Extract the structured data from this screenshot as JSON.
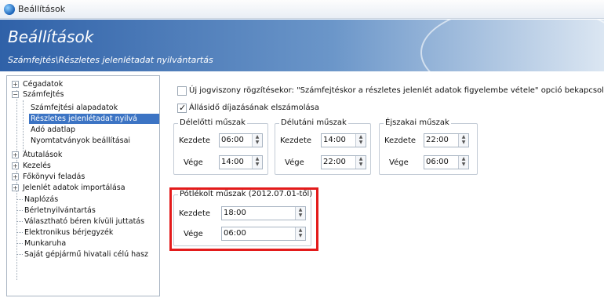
{
  "window": {
    "title": "Beállítások"
  },
  "banner": {
    "title": "Beállítások",
    "subtitle": "Számfejtés\\Részletes jelenlétadat nyilvántartás"
  },
  "sidebar": {
    "items": [
      {
        "label": "Cégadatok",
        "expander": "+"
      },
      {
        "label": "Számfejtés",
        "expander": "−"
      },
      {
        "label": "Számfejtési alapadatok"
      },
      {
        "label": "Részletes jelenlétadat nyilvá"
      },
      {
        "label": "Adó adatlap"
      },
      {
        "label": "Nyomtatványok beállításai"
      },
      {
        "label": "Átutalások",
        "expander": "+"
      },
      {
        "label": "Kezelés",
        "expander": "+"
      },
      {
        "label": "Főkönyvi feladás",
        "expander": "+"
      },
      {
        "label": "Jelenlét adatok importálása",
        "expander": "+"
      },
      {
        "label": "Naplózás"
      },
      {
        "label": "Bérletnyilvántartás"
      },
      {
        "label": "Választható béren kívüli juttatás"
      },
      {
        "label": "Elektronikus bérjegyzék"
      },
      {
        "label": "Munkaruha"
      },
      {
        "label": "Saját gépjármű hivatali célú hasz"
      }
    ]
  },
  "options": {
    "new_employment": "Új jogviszony rögzítésekor: \"Számfejtéskor a részletes jelenlét adatok figyelembe vétele\" opció bekapcsolása",
    "standby_fee": "Állásidő díjazásának elszámolása"
  },
  "shifts": {
    "start_label": "Kezdete",
    "end_label": "Vége",
    "morning": {
      "title": "Délelőtti műszak",
      "start": "06:00",
      "end": "14:00"
    },
    "afternoon": {
      "title": "Délutáni műszak",
      "start": "14:00",
      "end": "22:00"
    },
    "night": {
      "title": "Éjszakai műszak",
      "start": "22:00",
      "end": "06:00"
    },
    "supplemented": {
      "title": "Pótlékolt műszak (2012.07.01-től)",
      "start": "18:00",
      "end": "06:00"
    }
  },
  "spinner_glyphs": {
    "up": "▲",
    "down": "▼"
  },
  "colors": {
    "selection": "#3c74c4",
    "highlight_border": "#e31b1b",
    "banner": "#2f61a8"
  }
}
